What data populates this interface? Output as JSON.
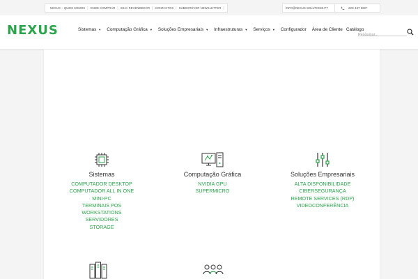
{
  "topbar": {
    "links": [
      "NEXUS – QUEM SOMOS",
      "ONDE COMPRAR",
      "SEJA REVENDEDOR",
      "CONTACTOS",
      "SUBSCREVER NEWSLETTER"
    ],
    "email": "INFO@NEXUS-SOLUTIONS.PT",
    "phone": "229 437 960*"
  },
  "header": {
    "logo": "NEXUS",
    "nav": [
      "Sistemas",
      "Computação Gráfica",
      "Soluções Empresariais",
      "Infraestruturas",
      "Serviços",
      "Configurador",
      "Área de Cliente",
      "Catálogo"
    ],
    "search_placeholder": "Pesquisar..."
  },
  "categories": [
    {
      "title": "Sistemas",
      "icon": "cpu-chip-icon",
      "items": [
        "Computador Desktop",
        "Computador All in One",
        "Mini-PC",
        "Terminais POS",
        "Workstations",
        "Servidores",
        "Storage"
      ]
    },
    {
      "title": "Computação Gráfica",
      "icon": "graphics-workstation-icon",
      "items": [
        "NVIDIA GPU",
        "SUPERMICRO"
      ]
    },
    {
      "title": "Soluções Empresariais",
      "icon": "sliders-icon",
      "items": [
        "Alta Disponibilidade",
        "Cibersegurança",
        "Remote Services (RDP)",
        "Videoconferência"
      ]
    }
  ],
  "colors": {
    "accent": "#2aa34a"
  }
}
